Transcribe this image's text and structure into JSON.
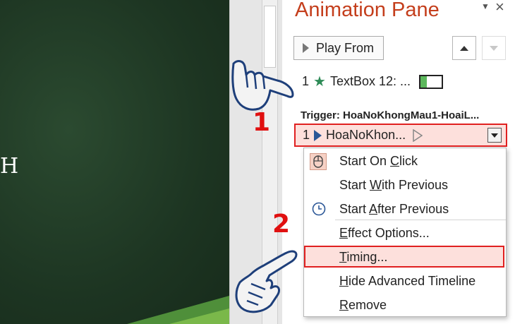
{
  "slide": {
    "letter": "H",
    "bg_color": "#1f3a24"
  },
  "pane": {
    "title": "Animation Pane",
    "menu_icon": "chevron-down-icon",
    "close_label": "×",
    "play_label": "Play From"
  },
  "items": {
    "first": {
      "number": "1",
      "icon": "star-icon",
      "label": "TextBox 12: ..."
    },
    "trigger_label": "Trigger: HoaNoKhongMau1-HoaiL...",
    "second": {
      "number": "1",
      "icon": "play-icon",
      "label": "HoaNoKhon..."
    }
  },
  "menu": {
    "start_on_click": {
      "before": "Start On ",
      "key": "C",
      "after": "lick"
    },
    "start_with_previous": {
      "before": "Start ",
      "key": "W",
      "after": "ith Previous"
    },
    "start_after_previous": {
      "before": "Start ",
      "key": "A",
      "after": "fter Previous"
    },
    "effect_options": {
      "before": "",
      "key": "E",
      "after": "ffect Options..."
    },
    "timing": {
      "before": "",
      "key": "T",
      "after": "iming..."
    },
    "hide_timeline": {
      "before": "",
      "key": "H",
      "after": "ide Advanced Timeline"
    },
    "remove": {
      "before": "",
      "key": "R",
      "after": "emove"
    }
  },
  "annotations": {
    "step1": "1",
    "step2": "2",
    "highlight_color": "#e02020"
  }
}
